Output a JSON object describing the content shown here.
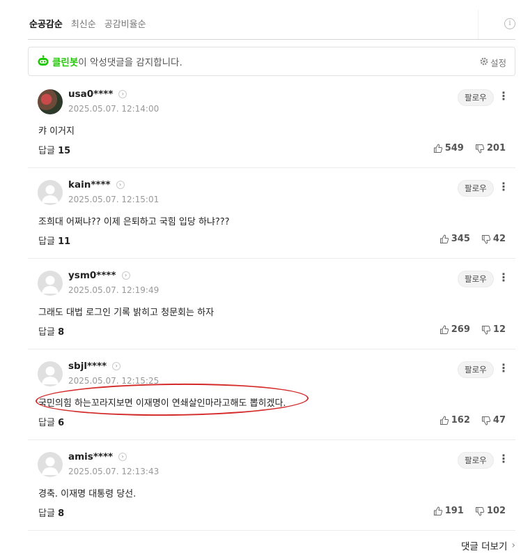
{
  "sort_tabs": [
    "순공감순",
    "최신순",
    "공감비율순"
  ],
  "cleanbot": {
    "name": "클린봇",
    "message": "이 악성댓글을 감지합니다.",
    "settings_label": "설정"
  },
  "comments": [
    {
      "author": "usa0****",
      "date": "2025.05.07. 12:14:00",
      "text": "캬 이거지",
      "reply_label": "답글",
      "reply_count": "15",
      "likes": "549",
      "dislikes": "201",
      "follow_label": "팔로우"
    },
    {
      "author": "kain****",
      "date": "2025.05.07. 12:15:01",
      "text": "조희대 어쩌냐?? 이제 은퇴하고 국힘 입당 하냐???",
      "reply_label": "답글",
      "reply_count": "11",
      "likes": "345",
      "dislikes": "42",
      "follow_label": "팔로우"
    },
    {
      "author": "ysm0****",
      "date": "2025.05.07. 12:19:49",
      "text": "그래도 대법 로그인 기록 밝히고 청문회는 하자",
      "reply_label": "답글",
      "reply_count": "8",
      "likes": "269",
      "dislikes": "12",
      "follow_label": "팔로우"
    },
    {
      "author": "sbjl****",
      "date": "2025.05.07. 12:15:25",
      "text": "국민의힘 하는꼬라지보면 이재명이 연쇄살인마라고해도 뽑히겠다.",
      "reply_label": "답글",
      "reply_count": "6",
      "likes": "162",
      "dislikes": "47",
      "follow_label": "팔로우"
    },
    {
      "author": "amis****",
      "date": "2025.05.07. 12:13:43",
      "text": "경축. 이재명 대통령 당선.",
      "reply_label": "답글",
      "reply_count": "8",
      "likes": "191",
      "dislikes": "102",
      "follow_label": "팔로우"
    }
  ],
  "more_comments_label": "댓글 더보기",
  "colors": {
    "cleanbot_green": "#1ec800",
    "annotation_red": "#d42a2a"
  }
}
